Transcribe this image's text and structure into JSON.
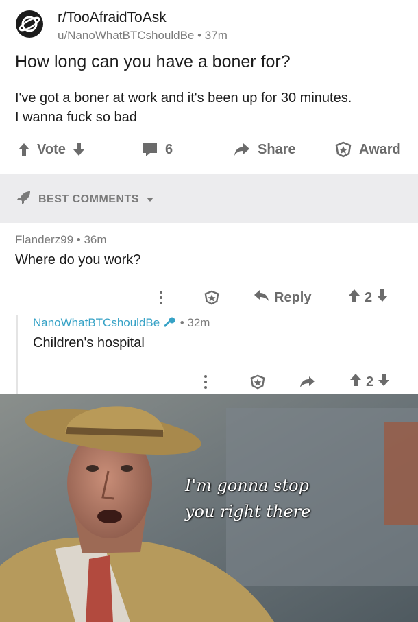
{
  "post": {
    "subreddit": "r/TooAfraidToAsk",
    "author_line": "u/NanoWhatBTCshouldBe • 37m",
    "title": "How long can you have a boner for?",
    "body_line1": "I've got a boner at work and it's been up for 30 minutes.",
    "body_line2": "I wanna fuck so bad"
  },
  "actions": {
    "vote_label": "Vote",
    "comment_count": "6",
    "share_label": "Share",
    "award_label": "Award"
  },
  "sort": {
    "label": "BEST COMMENTS"
  },
  "comments": [
    {
      "meta": "Flanderz99 • 36m",
      "text": "Where do you work?",
      "reply_label": "Reply",
      "score": "2"
    },
    {
      "author": "NanoWhatBTCshouldBe",
      "time": "• 32m",
      "text": "Children's hospital",
      "score": "2"
    }
  ],
  "meme": {
    "caption_line1": "I'm gonna stop",
    "caption_line2": "you right there"
  },
  "colors": {
    "accent_blue": "#36a2c6",
    "gray_text": "#7c7c7c",
    "bar_bg": "#ececee"
  }
}
